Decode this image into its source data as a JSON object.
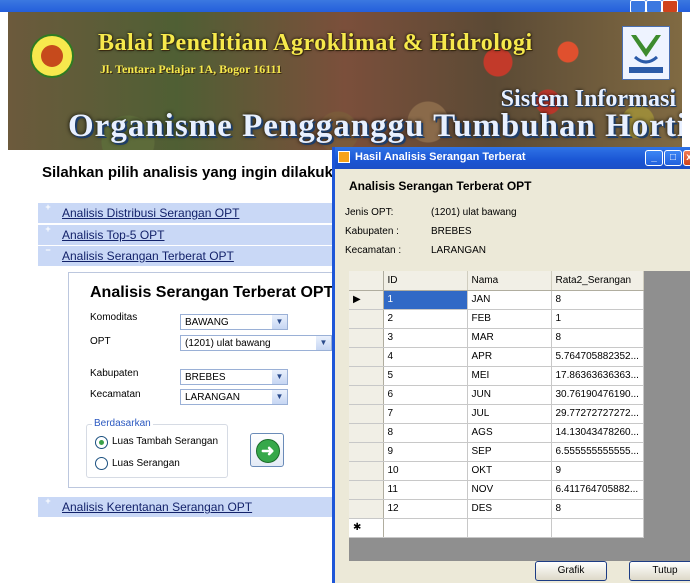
{
  "main_window": {
    "banner": {
      "title": "Balai Penelitian Agroklimat & Hidrologi",
      "address": "Jl. Tentara Pelajar 1A, Bogor 16111",
      "system_line1": "Sistem Informasi",
      "system_line2": "Organisme Pengganggu Tumbuhan Hortikultura"
    },
    "heading": "Silahkan pilih analisis yang ingin dilakukan",
    "sections": [
      {
        "label": "Analisis Distribusi Serangan OPT",
        "expander": "+"
      },
      {
        "label": "Analisis Top-5 OPT",
        "expander": "+"
      },
      {
        "label": "Analisis Serangan Terberat OPT",
        "expander": "−"
      },
      {
        "label": "Analisis Kerentanan Serangan OPT",
        "expander": "+"
      }
    ],
    "panel": {
      "title": "Analisis Serangan Terberat OPT",
      "komoditas_label": "Komoditas",
      "komoditas_value": "BAWANG",
      "opt_label": "OPT",
      "opt_value": "(1201) ulat bawang",
      "kabupaten_label": "Kabupaten",
      "kabupaten_value": "BREBES",
      "kecamatan_label": "Kecamatan",
      "kecamatan_value": "LARANGAN",
      "group_label": "Berdasarkan",
      "radio1": "Luas Tambah Serangan",
      "radio2": "Luas Serangan",
      "radio_selected": "Luas Tambah Serangan"
    }
  },
  "dialog": {
    "title": "Hasil Analisis Serangan Terberat",
    "heading": "Analisis Serangan Terberat OPT",
    "info": [
      {
        "label": "Jenis OPT:",
        "value": "(1201) ulat bawang"
      },
      {
        "label": "Kabupaten :",
        "value": "BREBES"
      },
      {
        "label": "Kecamatan :",
        "value": "LARANGAN"
      }
    ],
    "grid": {
      "columns": [
        "ID",
        "Nama",
        "Rata2_Serangan"
      ],
      "rows": [
        [
          "1",
          "JAN",
          "8"
        ],
        [
          "2",
          "FEB",
          "1"
        ],
        [
          "3",
          "MAR",
          "8"
        ],
        [
          "4",
          "APR",
          "5.764705882352..."
        ],
        [
          "5",
          "MEI",
          "17.86363636363..."
        ],
        [
          "6",
          "JUN",
          "30.76190476190..."
        ],
        [
          "7",
          "JUL",
          "29.77272727272..."
        ],
        [
          "8",
          "AGS",
          "14.13043478260..."
        ],
        [
          "9",
          "SEP",
          "6.555555555555..."
        ],
        [
          "10",
          "OKT",
          "9"
        ],
        [
          "11",
          "NOV",
          "6.411764705882..."
        ],
        [
          "12",
          "DES",
          "8"
        ]
      ],
      "selected_row_marker": "▶",
      "new_row_marker": "✱"
    },
    "buttons": {
      "grafik": "Grafik",
      "tutup": "Tutup"
    }
  }
}
